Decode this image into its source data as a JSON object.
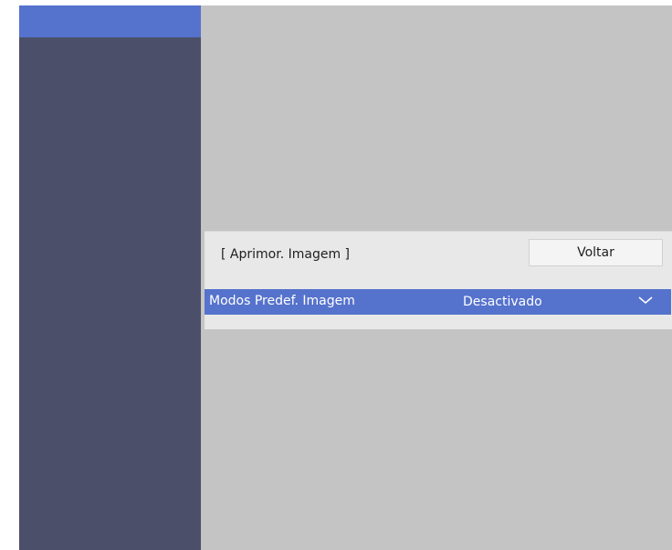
{
  "panel": {
    "title": "[ Aprimor. Imagem ]",
    "back_label": "Voltar"
  },
  "menu": {
    "items": [
      {
        "label": "Modos Predef. Imagem",
        "value": "Desactivado",
        "icon": "chevron-down-icon"
      }
    ]
  },
  "colors": {
    "sidebar": "#4b4f69",
    "sidebar_active": "#5572cc",
    "background": "#c4c4c4",
    "panel": "#e8e8e8",
    "selected_row": "#5572cc"
  }
}
